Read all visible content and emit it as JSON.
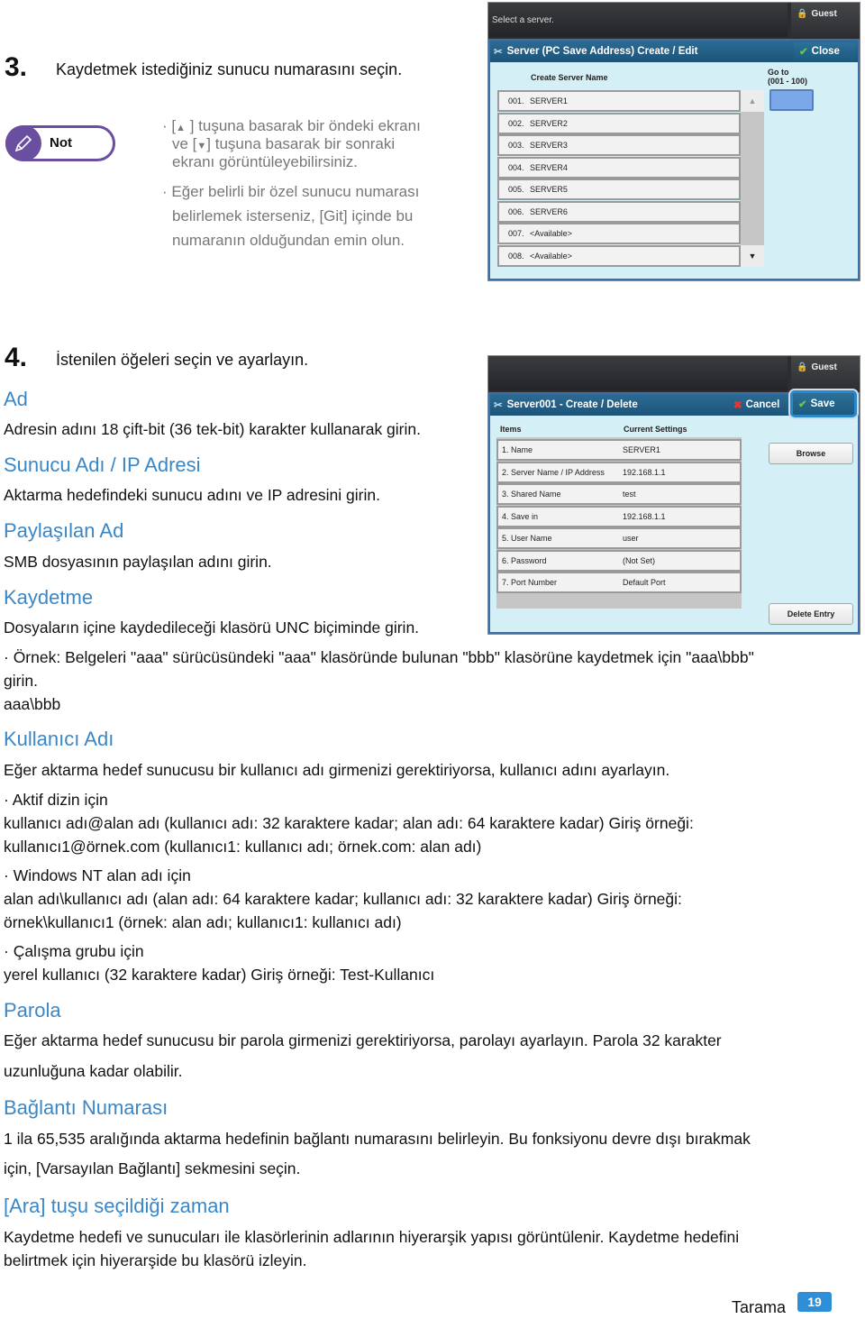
{
  "step3": {
    "number": "3.",
    "text": "Kaydetmek istediğiniz sunucu numarasını seçin."
  },
  "note": {
    "badge_label": "Not",
    "icon": "pencil-icon",
    "item1_line1_pre": "· [",
    "item1_up_icon": "▲",
    "item1_line1_post": " ] tuşuna basarak bir öndeki ekranı",
    "item1_line2_pre": "ve  [",
    "item1_down_icon": "▼",
    "item1_line2_post": "] tuşuna basarak bir  sonraki",
    "item1_line3": "ekranı görüntüleyebilirsiniz.",
    "item2_line1": "· Eğer belirli bir özel sunucu numarası",
    "item2_line2": "belirlemek isterseniz, [Git] içinde bu",
    "item2_line3": "numaranın olduğundan emin olun."
  },
  "screen1": {
    "status_text": "Select a server.",
    "guest_label": "Guest",
    "title": "Server (PC Save Address) Create / Edit",
    "close_label": "Close",
    "column_header": "Create Server Name",
    "goto_label_line1": "Go to",
    "goto_label_line2": "(001 - 100)",
    "goto_value": "",
    "rows": [
      {
        "num": "001.",
        "name": "SERVER1"
      },
      {
        "num": "002.",
        "name": "SERVER2"
      },
      {
        "num": "003.",
        "name": "SERVER3"
      },
      {
        "num": "004.",
        "name": "SERVER4"
      },
      {
        "num": "005.",
        "name": "SERVER5"
      },
      {
        "num": "006.",
        "name": "SERVER6"
      },
      {
        "num": "007.",
        "name": "<Available>"
      },
      {
        "num": "008.",
        "name": "<Available>"
      }
    ],
    "scroll_up": "▲",
    "scroll_down": "▼"
  },
  "step4": {
    "number": "4.",
    "text": "İstenilen öğeleri seçin ve ayarlayın."
  },
  "screen2": {
    "guest_label": "Guest",
    "title": "Server001 - Create / Delete",
    "cancel_label": "Cancel",
    "save_label": "Save",
    "col_items": "Items",
    "col_settings": "Current Settings",
    "rows": [
      {
        "item": "1. Name",
        "value": "SERVER1"
      },
      {
        "item": "2. Server Name / IP Address",
        "value": "192.168.1.1"
      },
      {
        "item": "3. Shared Name",
        "value": "test"
      },
      {
        "item": "4. Save in",
        "value": "192.168.1.1"
      },
      {
        "item": "5. User Name",
        "value": "user"
      },
      {
        "item": "6. Password",
        "value": "(Not Set)"
      },
      {
        "item": "7. Port Number",
        "value": "Default Port"
      }
    ],
    "browse_label": "Browse",
    "delete_label": "Delete Entry"
  },
  "sections": {
    "ad": {
      "heading": "Ad",
      "text": "Adresin adını 18 çift-bit (36 tek-bit) karakter kullanarak girin."
    },
    "sunucu": {
      "heading": "Sunucu Adı / IP Adresi",
      "text": "Aktarma hedefindeki sunucu adını ve IP adresini girin."
    },
    "paylasilan": {
      "heading": "Paylaşılan Ad",
      "text": "SMB dosyasının paylaşılan adını girin."
    },
    "kaydetme": {
      "heading": "Kaydetme",
      "text": "Dosyaların içine kaydedileceği klasörü UNC biçiminde girin.",
      "example_line1": "·  Örnek: Belgeleri \"aaa\" sürücüsündeki \"aaa\" klasöründe bulunan \"bbb\" klasörüne kaydetmek için \"aaa\\bbb\"",
      "example_line2": "girin.",
      "example_value": "aaa\\bbb"
    },
    "kullanici": {
      "heading": "Kullanıcı Adı",
      "text": "Eğer aktarma hedef sunucusu bir kullanıcı adı girmenizi gerektiriyorsa, kullanıcı adını ayarlayın.",
      "ad_title": "·  Aktif dizin için",
      "ad_line1": "kullanıcı adı@alan adı (kullanıcı adı: 32 karaktere kadar; alan adı: 64 karaktere kadar) Giriş örneği:",
      "ad_line2": "kullanıcı1@örnek.com (kullanıcı1: kullanıcı adı; örnek.com: alan adı)",
      "nt_title": "·  Windows NT alan adı için",
      "nt_line1": "alan adı\\kullanıcı adı (alan adı: 64 karaktere kadar; kullanıcı adı: 32 karaktere kadar) Giriş örneği:",
      "nt_line2": "örnek\\kullanıcı1 (örnek: alan adı; kullanıcı1: kullanıcı adı)",
      "wg_title": "·  Çalışma grubu için",
      "wg_line1": "yerel kullanıcı (32 karaktere kadar) Giriş örneği:  Test-Kullanıcı"
    },
    "parola": {
      "heading": "Parola",
      "line1": "Eğer aktarma hedef sunucusu bir parola girmenizi gerektiriyorsa, parolayı ayarlayın. Parola 32 karakter",
      "line2": "uzunluğuna kadar olabilir."
    },
    "baglanti": {
      "heading": "Bağlantı Numarası",
      "line1": "1 ila 65,535 aralığında aktarma hedefinin bağlantı numarasını belirleyin. Bu fonksiyonu devre dışı bırakmak",
      "line2": "için, [Varsayılan Bağlantı] sekmesini seçin."
    },
    "ara": {
      "heading": "[Ara] tuşu seçildiği zaman",
      "line1": "Kaydetme hedefi ve sunucuları ile klasörlerinin adlarının hiyerarşik yapısı görüntülenir.  Kaydetme hedefini",
      "line2": "belirtmek için hiyerarşide bu klasörü izleyin."
    }
  },
  "footer": {
    "section": "Tarama",
    "page": "19"
  },
  "colors": {
    "heading_blue": "#3a87c8",
    "note_purple": "#6a4ea0",
    "page_badge": "#2e8fd8"
  }
}
